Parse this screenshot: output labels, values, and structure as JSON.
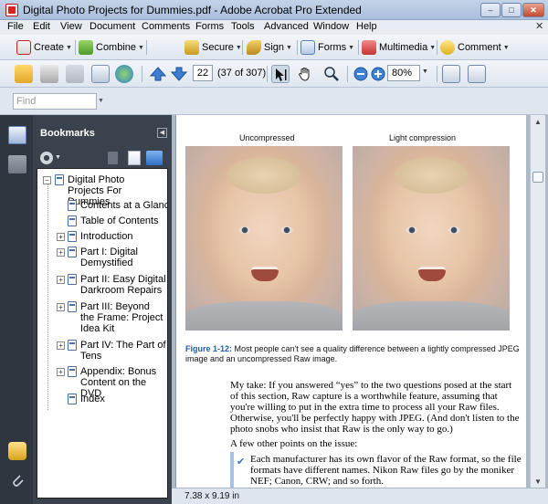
{
  "window": {
    "title": "Digital Photo Projects for Dummies.pdf - Adobe Acrobat Pro Extended",
    "minimize": "–",
    "maximize": "□",
    "close": "✕",
    "menu_close": "✕"
  },
  "menu": [
    "File",
    "Edit",
    "View",
    "Document",
    "Comments",
    "Forms",
    "Tools",
    "Advanced",
    "Window",
    "Help"
  ],
  "toolbar": {
    "tasks": [
      {
        "label": "Create",
        "icon": "create-pdf-icon"
      },
      {
        "label": "Combine",
        "icon": "combine-files-icon"
      },
      {
        "label": "Secure",
        "icon": "lock-icon"
      },
      {
        "label": "Sign",
        "icon": "pen-sign-icon"
      },
      {
        "label": "Forms",
        "icon": "forms-icon"
      },
      {
        "label": "Multimedia",
        "icon": "multimedia-icon"
      },
      {
        "label": "Comment",
        "icon": "comment-icon"
      }
    ]
  },
  "navigation": {
    "page_number": "22",
    "page_count": "(37 of 307)",
    "zoom": "80%"
  },
  "find": {
    "placeholder": "Find"
  },
  "bookmarks": {
    "title": "Bookmarks",
    "items": [
      {
        "label": "Digital Photo Projects For Dummies",
        "expander": "−"
      },
      {
        "label": "Contents at a Glance",
        "expander": ""
      },
      {
        "label": "Table of Contents",
        "expander": ""
      },
      {
        "label": "Introduction",
        "expander": "+"
      },
      {
        "label": "Part I: Digital Demystified",
        "expander": "+"
      },
      {
        "label": "Part II: Easy Digital Darkroom Repairs",
        "expander": "+"
      },
      {
        "label": "Part III: Beyond the Frame: Project Idea Kit",
        "expander": "+"
      },
      {
        "label": "Part IV: The Part of Tens",
        "expander": "+"
      },
      {
        "label": "Appendix: Bonus Content on the DVD",
        "expander": "+"
      },
      {
        "label": "Index",
        "expander": ""
      }
    ]
  },
  "document": {
    "label_left": "Uncompressed",
    "label_right": "Light compression",
    "figure_label": "Figure 1-12:",
    "figure_caption": "Most people can't see a quality difference between a lightly compressed JPEG image and an uncompressed Raw image.",
    "paragraph1": "My take: If you answered “yes” to the two questions posed at the start of this section, Raw capture is a worthwhile feature, assuming that you're willing to put in the extra time to process all your Raw files. Otherwise, you'll be perfectly happy with JPEG. (And don't listen to the photo snobs who insist that Raw is the only way to go.)",
    "paragraph2": "A few other points on the issue:",
    "bullet1": "Each manufacturer has its own flavor of the Raw format, so the file formats have different names. Nikon Raw files go by the moniker NEF; Canon, CRW; and so forth."
  },
  "status": {
    "page_size": "7.38 x 9.19 in"
  }
}
